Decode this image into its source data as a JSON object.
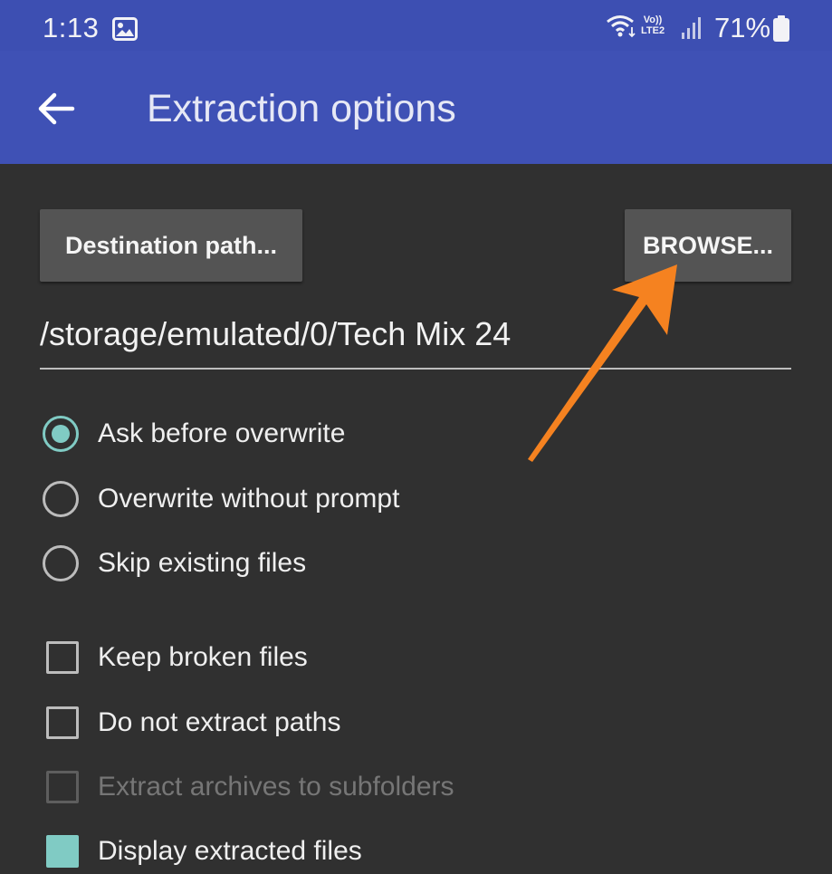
{
  "status_bar": {
    "time": "1:13",
    "volte_line1": "Vo))",
    "volte_line2": "LTE2",
    "battery": "71%",
    "icons": [
      "image-icon",
      "wifi-icon",
      "signal-icon",
      "battery-icon"
    ]
  },
  "app_bar": {
    "back_icon": "arrow-left-icon",
    "title": "Extraction options",
    "color": "#3f51b5"
  },
  "destination": {
    "path_button": "Destination path...",
    "browse_button": "BROWSE...",
    "path_value": "/storage/emulated/0/Tech Mix 24"
  },
  "overwrite_modes": [
    {
      "label": "Ask before overwrite",
      "selected": true
    },
    {
      "label": "Overwrite without prompt",
      "selected": false
    },
    {
      "label": "Skip existing files",
      "selected": false
    }
  ],
  "options": [
    {
      "label": "Keep broken files",
      "checked": false,
      "enabled": true
    },
    {
      "label": "Do not extract paths",
      "checked": false,
      "enabled": true
    },
    {
      "label": "Extract archives to subfolders",
      "checked": false,
      "enabled": false
    },
    {
      "label": "Display extracted files",
      "checked": true,
      "enabled": true
    }
  ],
  "accent_color": "#80cbc4",
  "annotation": {
    "arrow_color": "#f58220",
    "points_to": "browse-button"
  }
}
